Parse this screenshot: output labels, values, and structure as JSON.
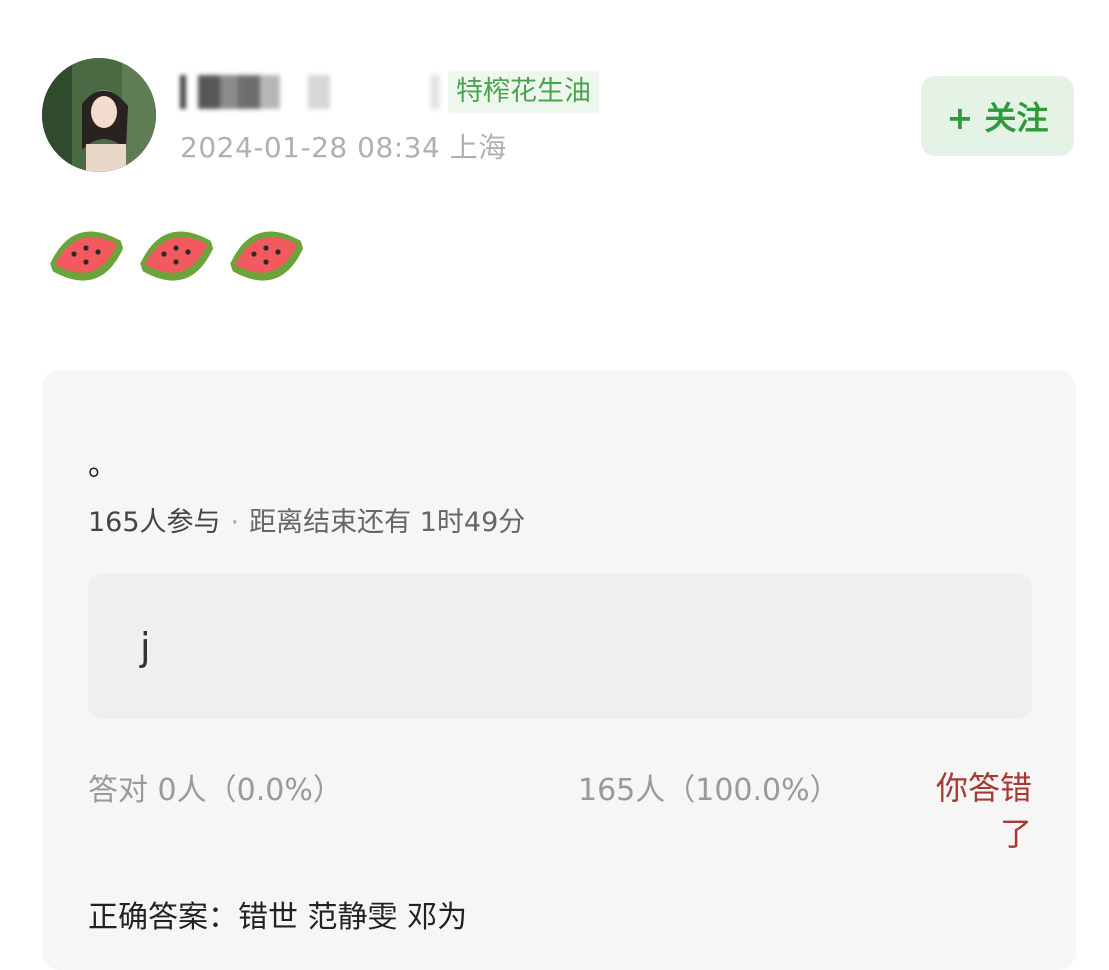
{
  "post": {
    "author_tag": "特榨花生油",
    "timestamp": "2024-01-28 08:34",
    "location": "上海",
    "follow_label": "+ 关注",
    "emojis": [
      "watermelon-icon",
      "watermelon-icon",
      "watermelon-icon"
    ]
  },
  "quiz": {
    "question": "。",
    "participants": "165人参与",
    "time_left": "距离结束还有 1时49分",
    "option_text": "j",
    "correct_stat": "答对  0人（0.0%）",
    "wrong_stat": "165人（100.0%）",
    "result_label": "你答错了",
    "answer": "正确答案：错世 范静雯 邓为"
  },
  "colors": {
    "accent_green": "#2f9a3a",
    "tag_green": "#4aa44e",
    "wrong_red": "#a73a32",
    "card_bg": "#f6f6f6"
  }
}
